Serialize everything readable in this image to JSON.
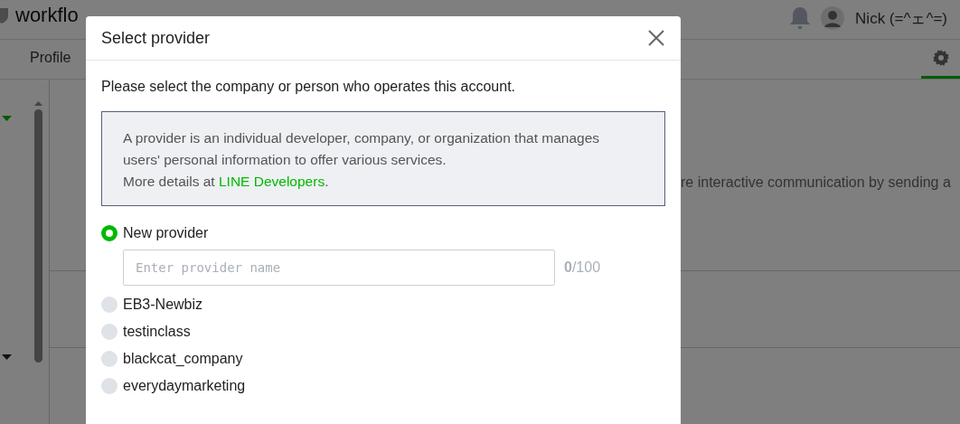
{
  "header": {
    "account_name": "workflo",
    "user_name": "Nick (=^ェ^=)"
  },
  "tabs": [
    {
      "label": "Profile",
      "selected": false
    }
  ],
  "settings_tab": {
    "selected": true
  },
  "sidebar": {
    "sections": [
      {
        "selected": true
      },
      {
        "selected": false
      }
    ]
  },
  "content": {
    "description": "re interactive communication by sending a"
  },
  "dialog": {
    "title": "Select provider",
    "prompt": "Please select the company or person who operates this account.",
    "info": {
      "text": "A provider is an individual developer, company, or organization that manages users' personal information to offer various services.",
      "link_prefix": "More details at ",
      "link": "LINE Developers",
      "link_suffix": "."
    },
    "options": [
      {
        "kind": "new",
        "label": "New provider",
        "selected": true,
        "placeholder": "Enter provider name",
        "counter": "**0**/100"
      },
      {
        "kind": "existing",
        "label": "EB3-Newbiz",
        "selected": false
      },
      {
        "kind": "existing",
        "label": "testinclass",
        "selected": false
      },
      {
        "kind": "existing",
        "label": "blackcat_company",
        "selected": false
      },
      {
        "kind": "existing",
        "label": "everydaymarketing",
        "selected": false
      }
    ]
  }
}
